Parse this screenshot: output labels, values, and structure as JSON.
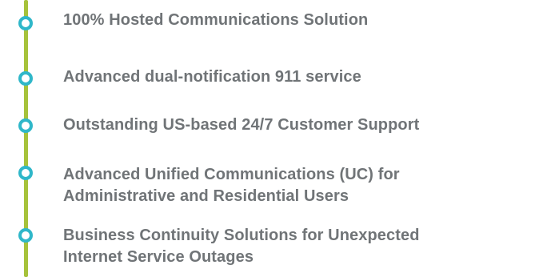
{
  "features": {
    "items": [
      {
        "lines": [
          "100% Hosted Communications Solution"
        ],
        "icon": "circle-bullet-icon"
      },
      {
        "lines": [
          "Advanced dual-notification 911 service"
        ],
        "icon": "circle-bullet-icon"
      },
      {
        "lines": [
          "Outstanding US-based 24/7 Customer Support"
        ],
        "icon": "circle-bullet-icon"
      },
      {
        "lines": [
          "Advanced Unified Communications (UC) for",
          "Administrative and Residential Users"
        ],
        "icon": "circle-bullet-icon"
      },
      {
        "lines": [
          "Business Continuity Solutions for Unexpected",
          "Internet Service Outages"
        ],
        "icon": "circle-bullet-icon"
      }
    ]
  },
  "colors": {
    "timeline": "#a6c23b",
    "bullet": "#2fb7c9",
    "text": "#707477"
  }
}
